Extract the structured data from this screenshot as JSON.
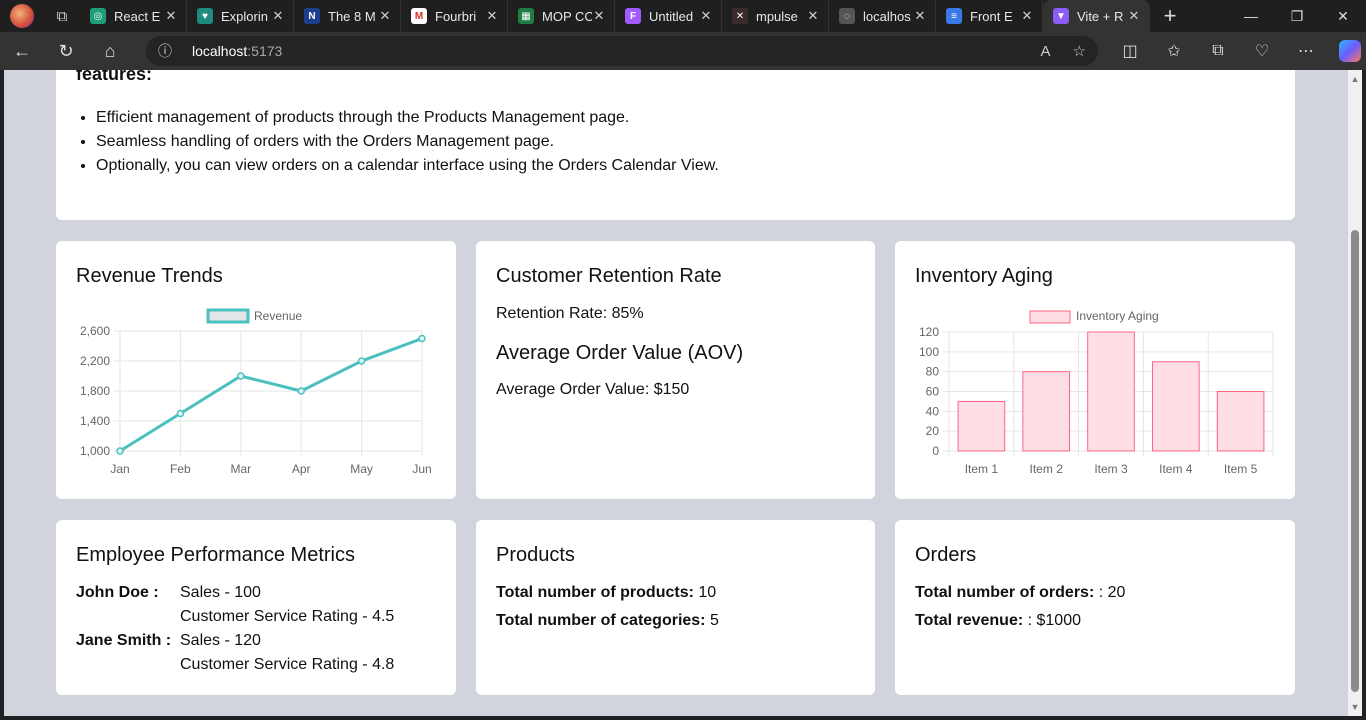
{
  "browser": {
    "tabs": [
      {
        "title": "React E",
        "color": "#1f9e7a",
        "glyph": "◎"
      },
      {
        "title": "Explorin",
        "color": "#1e8c7e",
        "glyph": "♥"
      },
      {
        "title": "The 8 M",
        "color": "#1d3f8f",
        "glyph": "N"
      },
      {
        "title": "Fourbri",
        "color": "#ffffff",
        "glyph": "M"
      },
      {
        "title": "MOP CC",
        "color": "#1e7e45",
        "glyph": "▦"
      },
      {
        "title": "Untitled",
        "color": "#a259ff",
        "glyph": "F"
      },
      {
        "title": "mpulse",
        "color": "#3a2a2a",
        "glyph": "✕"
      },
      {
        "title": "localhos",
        "color": "#555555",
        "glyph": "◌"
      },
      {
        "title": "Front E",
        "color": "#3b78e7",
        "glyph": "≡"
      },
      {
        "title": "Vite + R",
        "color": "#8b5cf6",
        "glyph": "▼",
        "active": true
      }
    ],
    "url_host": "localhost",
    "url_port": ":5173"
  },
  "intro": {
    "heading": "features:",
    "items": [
      "Efficient management of products through the Products Management page.",
      "Seamless handling of orders with the Orders Management page.",
      "Optionally, you can view orders on a calendar interface using the Orders Calendar View."
    ]
  },
  "revenue": {
    "title": "Revenue Trends",
    "chart_data": {
      "type": "line",
      "categories": [
        "Jan",
        "Feb",
        "Mar",
        "Apr",
        "May",
        "Jun"
      ],
      "series": [
        {
          "name": "Revenue",
          "values": [
            1000,
            1500,
            2000,
            1800,
            2200,
            2500
          ]
        }
      ],
      "yticks": [
        "1,000",
        "1,400",
        "1,800",
        "2,200",
        "2,600"
      ],
      "ylim": [
        1000,
        2600
      ],
      "color": "#4bc0c0",
      "legend": "top"
    }
  },
  "retention": {
    "title": "Customer Retention Rate",
    "rate_text": "Retention Rate: 85%",
    "aov_title": "Average Order Value (AOV)",
    "aov_text": "Average Order Value: $150"
  },
  "inventory": {
    "title": "Inventory Aging",
    "chart_data": {
      "type": "bar",
      "categories": [
        "Item 1",
        "Item 2",
        "Item 3",
        "Item 4",
        "Item 5"
      ],
      "series": [
        {
          "name": "Inventory Aging",
          "values": [
            50,
            80,
            120,
            90,
            60
          ]
        }
      ],
      "yticks": [
        "0",
        "20",
        "40",
        "60",
        "80",
        "100",
        "120"
      ],
      "ylim": [
        0,
        120
      ],
      "color": "#ff6384",
      "fill": "#ffdfe5",
      "legend": "top"
    }
  },
  "employees": {
    "title": "Employee Performance Metrics",
    "rows": [
      {
        "name": "John Doe :",
        "sales": "Sales - 100",
        "rating": "Customer Service Rating - 4.5"
      },
      {
        "name": "Jane Smith :",
        "sales": "Sales - 120",
        "rating": "Customer Service Rating - 4.8"
      }
    ]
  },
  "products": {
    "title": "Products",
    "total_label": "Total number of products:",
    "total_value": " 10",
    "cat_label": "Total number of categories:",
    "cat_value": " 5"
  },
  "orders": {
    "title": "Orders",
    "total_label": "Total number of orders:",
    "total_value": " : 20",
    "rev_label": "Total revenue:",
    "rev_value": " : $1000"
  }
}
